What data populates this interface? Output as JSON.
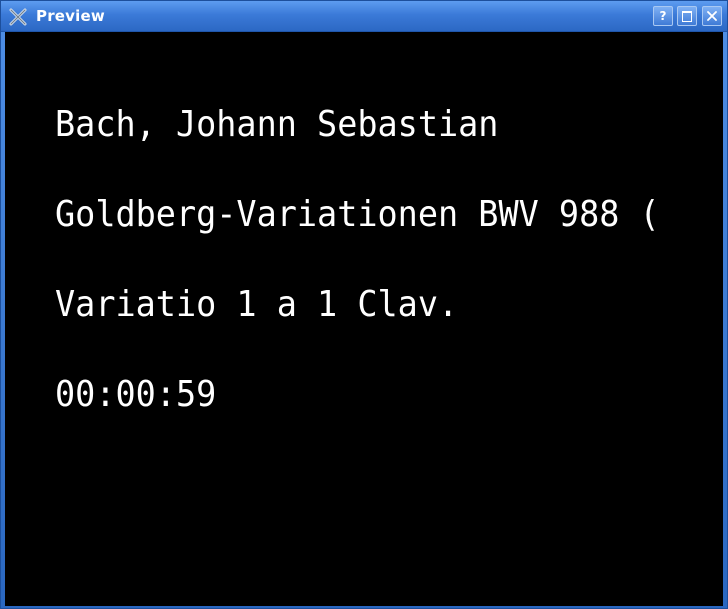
{
  "window": {
    "title": "Preview",
    "icons": {
      "app": "close-x-app-icon",
      "help": "help-icon",
      "maximize": "maximize-icon",
      "close": "close-icon"
    },
    "buttons": {
      "help_label": "?"
    }
  },
  "preview": {
    "artist": "Bach, Johann Sebastian",
    "album": "Goldberg-Variationen BWV 988 (",
    "track": "Variatio 1 a 1 Clav.",
    "time": "00:00:59"
  },
  "colors": {
    "background": "#000000",
    "text": "#ffffff",
    "titlebar": "#3b7ad8"
  }
}
